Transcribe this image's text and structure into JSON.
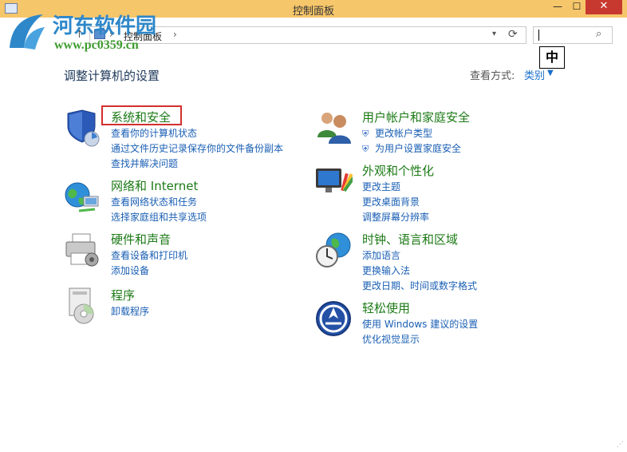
{
  "window": {
    "title": "控制面板",
    "min_glyph": "—",
    "max_glyph": "☐",
    "close_glyph": "✕"
  },
  "watermark": {
    "title": "河东软件园",
    "url": "www.pc0359.cn"
  },
  "toolbar": {
    "breadcrumb": "控制面板",
    "search_placeholder": "",
    "ime_indicator": "中"
  },
  "heading": "调整计算机的设置",
  "view": {
    "label": "查看方式:",
    "value": "类别"
  },
  "categories": [
    {
      "title": "系统和安全",
      "icon": "shield-icon",
      "links": [
        "查看你的计算机状态",
        "通过文件历史记录保存你的文件备份副本",
        "查找并解决问题"
      ]
    },
    {
      "title": "网络和 Internet",
      "icon": "network-globe-icon",
      "links": [
        "查看网络状态和任务",
        "选择家庭组和共享选项"
      ]
    },
    {
      "title": "硬件和声音",
      "icon": "printer-icon",
      "links": [
        "查看设备和打印机",
        "添加设备"
      ]
    },
    {
      "title": "程序",
      "icon": "programs-icon",
      "links": [
        "卸载程序"
      ]
    },
    {
      "title": "用户帐户和家庭安全",
      "icon": "users-icon",
      "links": [
        "更改帐户类型",
        "为用户设置家庭安全"
      ]
    },
    {
      "title": "外观和个性化",
      "icon": "monitor-palette-icon",
      "links": [
        "更改主题",
        "更改桌面背景",
        "调整屏幕分辨率"
      ]
    },
    {
      "title": "时钟、语言和区域",
      "icon": "clock-globe-icon",
      "links": [
        "添加语言",
        "更换输入法",
        "更改日期、时间或数字格式"
      ]
    },
    {
      "title": "轻松使用",
      "icon": "ease-of-access-icon",
      "links": [
        "使用 Windows 建议的设置",
        "优化视觉显示"
      ]
    }
  ]
}
